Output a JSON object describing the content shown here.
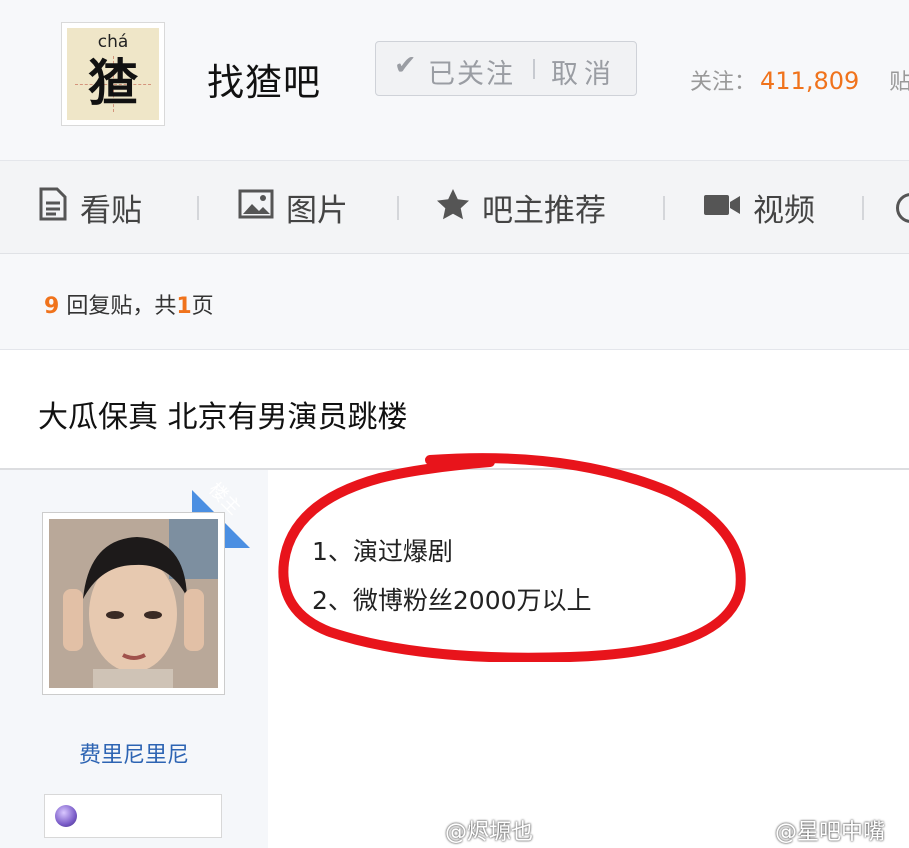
{
  "header": {
    "logo": {
      "pinyin": "chá",
      "char": "猹"
    },
    "bar_name": "找猹吧",
    "follow_button": {
      "check_icon": "check-icon",
      "followed_label": "已关注",
      "cancel_label": "取消"
    },
    "stats": {
      "followers_label": "关注：",
      "followers_count": "411,809",
      "posts_label": "贴"
    }
  },
  "nav": {
    "tabs": [
      {
        "label": "看贴",
        "icon": "document-icon"
      },
      {
        "label": "图片",
        "icon": "image-icon"
      },
      {
        "label": "吧主推荐",
        "icon": "star-icon"
      },
      {
        "label": "视频",
        "icon": "video-camera-icon"
      }
    ]
  },
  "thread": {
    "reply_count": "9",
    "reply_suffix": "回复贴，共",
    "page_count": "1",
    "page_suffix": "页",
    "title": "大瓜保真 北京有男演员跳楼"
  },
  "post": {
    "op_badge": "楼主",
    "author_name": "费里尼里尼",
    "lines": [
      "1、演过爆剧",
      "2、微博粉丝2000万以上"
    ],
    "annotation_color": "#e8141b"
  },
  "watermarks": [
    "@烬塬也",
    "@星吧中嘴"
  ],
  "colors": {
    "accent_orange": "#f0731c",
    "link_blue": "#2d64b3",
    "ribbon_blue": "#4b8fe2"
  }
}
